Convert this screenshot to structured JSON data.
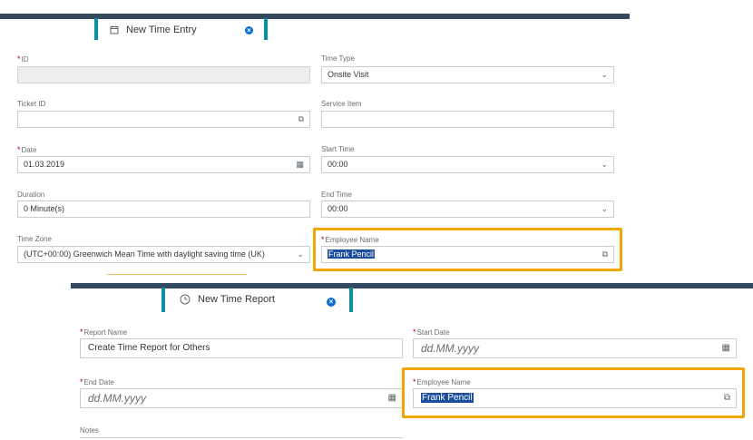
{
  "entry": {
    "tab_title": "New Time Entry",
    "fields": {
      "id_label": "ID",
      "id_value": "",
      "time_type_label": "Time Type",
      "time_type_value": "Onsite Visit",
      "ticket_id_label": "Ticket ID",
      "ticket_id_value": "",
      "service_item_label": "Service Item",
      "service_item_value": "",
      "date_label": "Date",
      "date_value": "01.03.2019",
      "start_time_label": "Start Time",
      "start_time_value": "00:00",
      "duration_label": "Duration",
      "duration_value": "0 Minute(s)",
      "end_time_label": "End Time",
      "end_time_value": "00:00",
      "time_zone_label": "Time Zone",
      "time_zone_value": "(UTC+00:00) Greenwich Mean Time with daylight saving time (UK)",
      "employee_name_label": "Employee Name",
      "employee_name_value": "Frank Pencil"
    }
  },
  "report": {
    "tab_title": "New Time Report",
    "fields": {
      "report_name_label": "Report Name",
      "report_name_value": "Create Time Report for Others",
      "start_date_label": "Start Date",
      "start_date_placeholder": "dd.MM.yyyy",
      "end_date_label": "End Date",
      "end_date_placeholder": "dd.MM.yyyy",
      "employee_name_label": "Employee Name",
      "employee_name_value": "Frank Pencil",
      "notes_label": "Notes"
    }
  },
  "icons": {
    "dropdown": "chevron-down-icon",
    "value_help": "value-help-icon",
    "calendar": "calendar-icon",
    "close": "close-icon"
  },
  "colors": {
    "header": "#354a5f",
    "tab_accent": "#0a8fa3",
    "highlight": "#f0a500",
    "required": "#bb0000"
  }
}
